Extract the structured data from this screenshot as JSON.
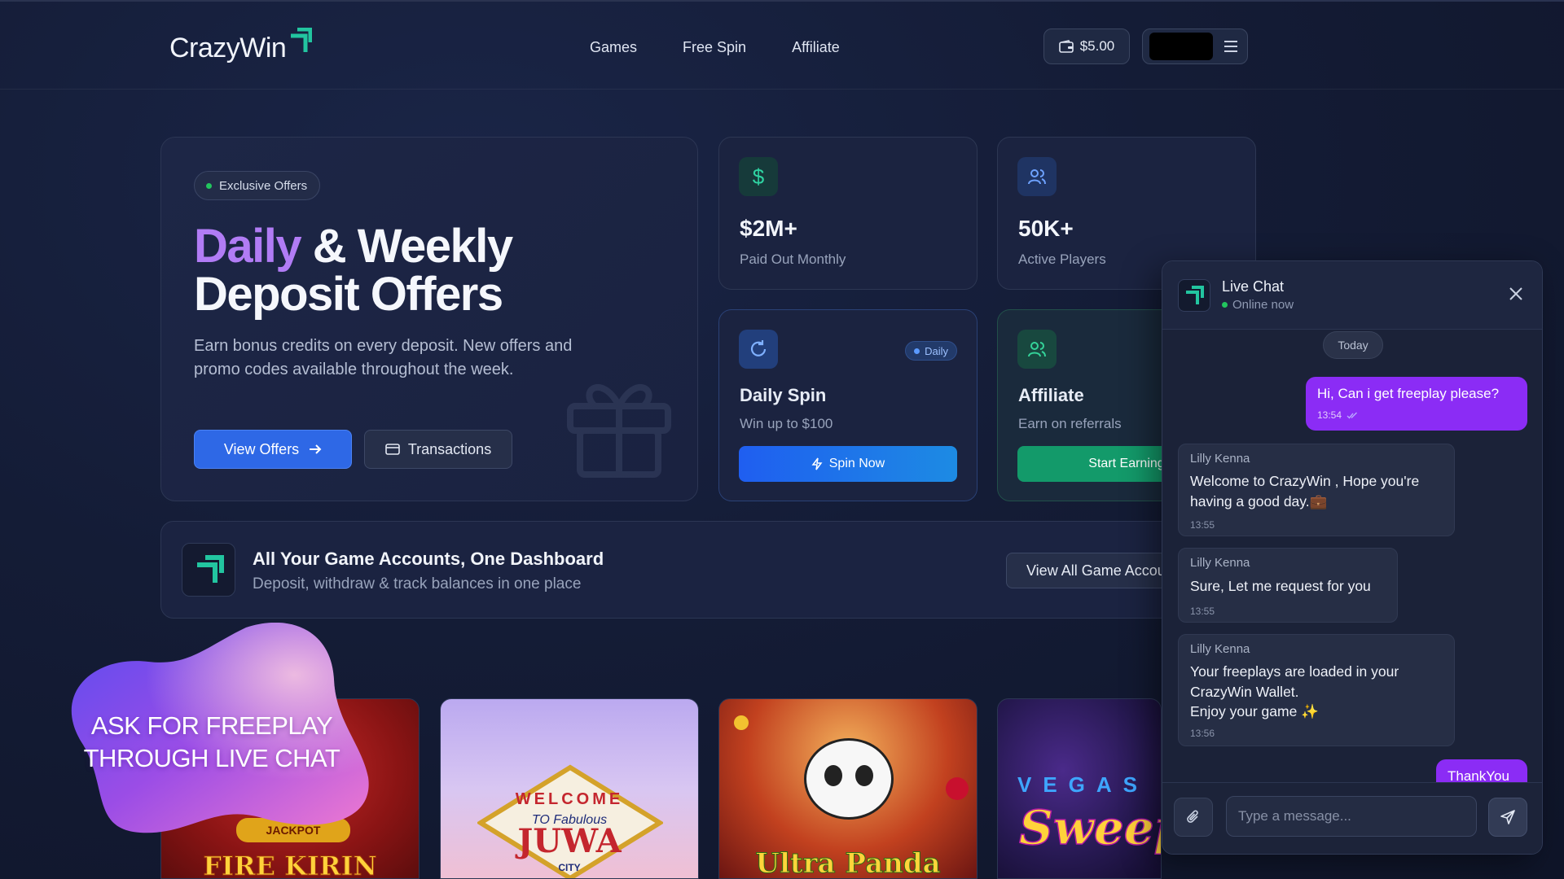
{
  "header": {
    "brand": "CrazyWin",
    "nav": [
      {
        "label": "Games"
      },
      {
        "label": "Free Spin"
      },
      {
        "label": "Affiliate"
      }
    ],
    "wallet_balance": "$5.00"
  },
  "hero": {
    "badge": "Exclusive Offers",
    "title_accent": "Daily",
    "title_rest": " & Weekly",
    "title_line2": "Deposit Offers",
    "description": "Earn bonus credits on every deposit. New offers and promo codes available throughout the week.",
    "primary_button": "View Offers",
    "secondary_button": "Transactions"
  },
  "stats": [
    {
      "value": "$2M+",
      "label": "Paid Out Monthly"
    },
    {
      "value": "50K+",
      "label": "Active Players"
    }
  ],
  "daily_spin": {
    "pill": "Daily",
    "title": "Daily Spin",
    "description": "Win up to $100",
    "button": "Spin Now"
  },
  "affiliate": {
    "title": "Affiliate",
    "description": "Earn on referrals",
    "button": "Start Earning"
  },
  "dashboard": {
    "title": "All Your Game Accounts, One Dashboard",
    "subtitle": "Deposit, withdraw & track balances in one place",
    "button": "View All Game Accounts"
  },
  "games": [
    {
      "name": "FIRE KIRIN",
      "tag": "JACKPOT"
    },
    {
      "name": "JUWA",
      "tag": "WELCOME",
      "sub": "TO Fabulous",
      "city": "CITY"
    },
    {
      "name": "Ultra Panda"
    },
    {
      "name": "Sweep",
      "tag": "VEGAS"
    }
  ],
  "promo": {
    "line1": "ASK FOR FREEPLAY",
    "line2": "THROUGH LIVE CHAT"
  },
  "chat": {
    "title": "Live Chat",
    "status": "Online now",
    "date_divider": "Today",
    "messages": [
      {
        "from": "me",
        "text": "Hi, Can i get freeplay please?",
        "time": "13:54"
      },
      {
        "from": "Lilly Kenna",
        "text": "Welcome to CrazyWin , Hope you're having a good day.💼",
        "time": "13:55"
      },
      {
        "from": "Lilly Kenna",
        "text": "Sure, Let me request for you",
        "time": "13:55"
      },
      {
        "from": "Lilly Kenna",
        "text_lines": [
          "Your freeplays are loaded in your",
          "CrazyWin Wallet.",
          "Enjoy your game ✨"
        ],
        "time": "13:56"
      },
      {
        "from": "me",
        "text": "ThankYou"
      }
    ],
    "input_placeholder": "Type a message..."
  },
  "colors": {
    "accent_purple": "#b17cf5",
    "primary_blue": "#2e68e6",
    "brand_green": "#22c55e",
    "chat_bubble": "#8b2cf5"
  }
}
